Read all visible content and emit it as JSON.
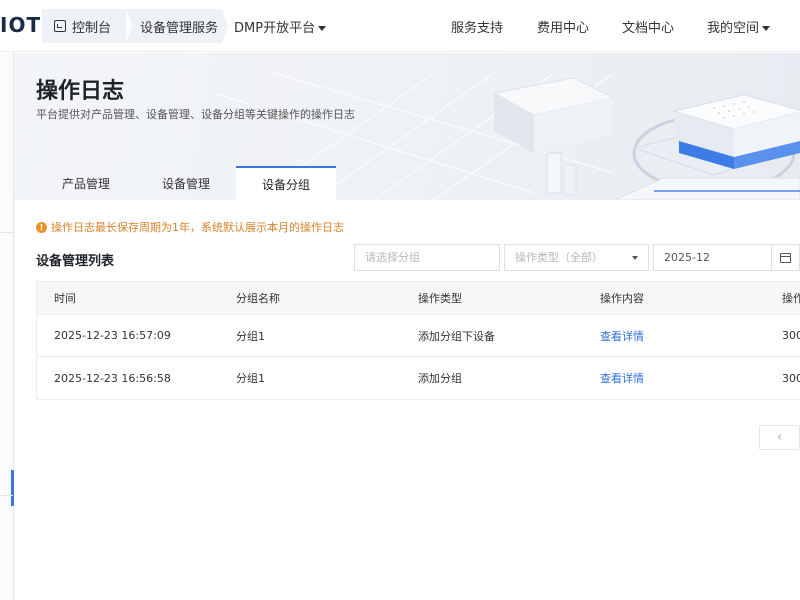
{
  "topnav": {
    "logo": "IOT",
    "console": "控制台",
    "crumb": "设备管理服务",
    "dmp": "DMP开放平台",
    "support": "服务支持",
    "billing": "费用中心",
    "docs": "文档中心",
    "my_space": "我的空间"
  },
  "banner": {
    "title": "操作日志",
    "description": "平台提供对产品管理、设备管理、设备分组等关键操作的操作日志"
  },
  "tabs": [
    {
      "label": "产品管理",
      "active": false
    },
    {
      "label": "设备管理",
      "active": false
    },
    {
      "label": "设备分组",
      "active": true
    }
  ],
  "notice": {
    "icon": "warning-icon",
    "text": "操作日志最长保存周期为1年，系统默认展示本月的操作日志"
  },
  "list": {
    "title": "设备管理列表"
  },
  "filters": {
    "group_placeholder": "请选择分组",
    "type_placeholder": "操作类型（全部）",
    "date_value": "2025-12"
  },
  "table": {
    "headers": [
      "时间",
      "分组名称",
      "操作类型",
      "操作内容",
      "操作"
    ],
    "rows": [
      {
        "time": "2025-12-23 16:57:09",
        "group": "分组1",
        "type": "添加分组下设备",
        "content": "查看详情",
        "operator": "300"
      },
      {
        "time": "2025-12-23 16:56:58",
        "group": "分组1",
        "type": "添加分组",
        "content": "查看详情",
        "operator": "300"
      }
    ]
  },
  "pager": {
    "prev": "‹"
  },
  "colors": {
    "accent": "#3a78e0",
    "link": "#2f73d8",
    "warning": "#d9822b"
  }
}
